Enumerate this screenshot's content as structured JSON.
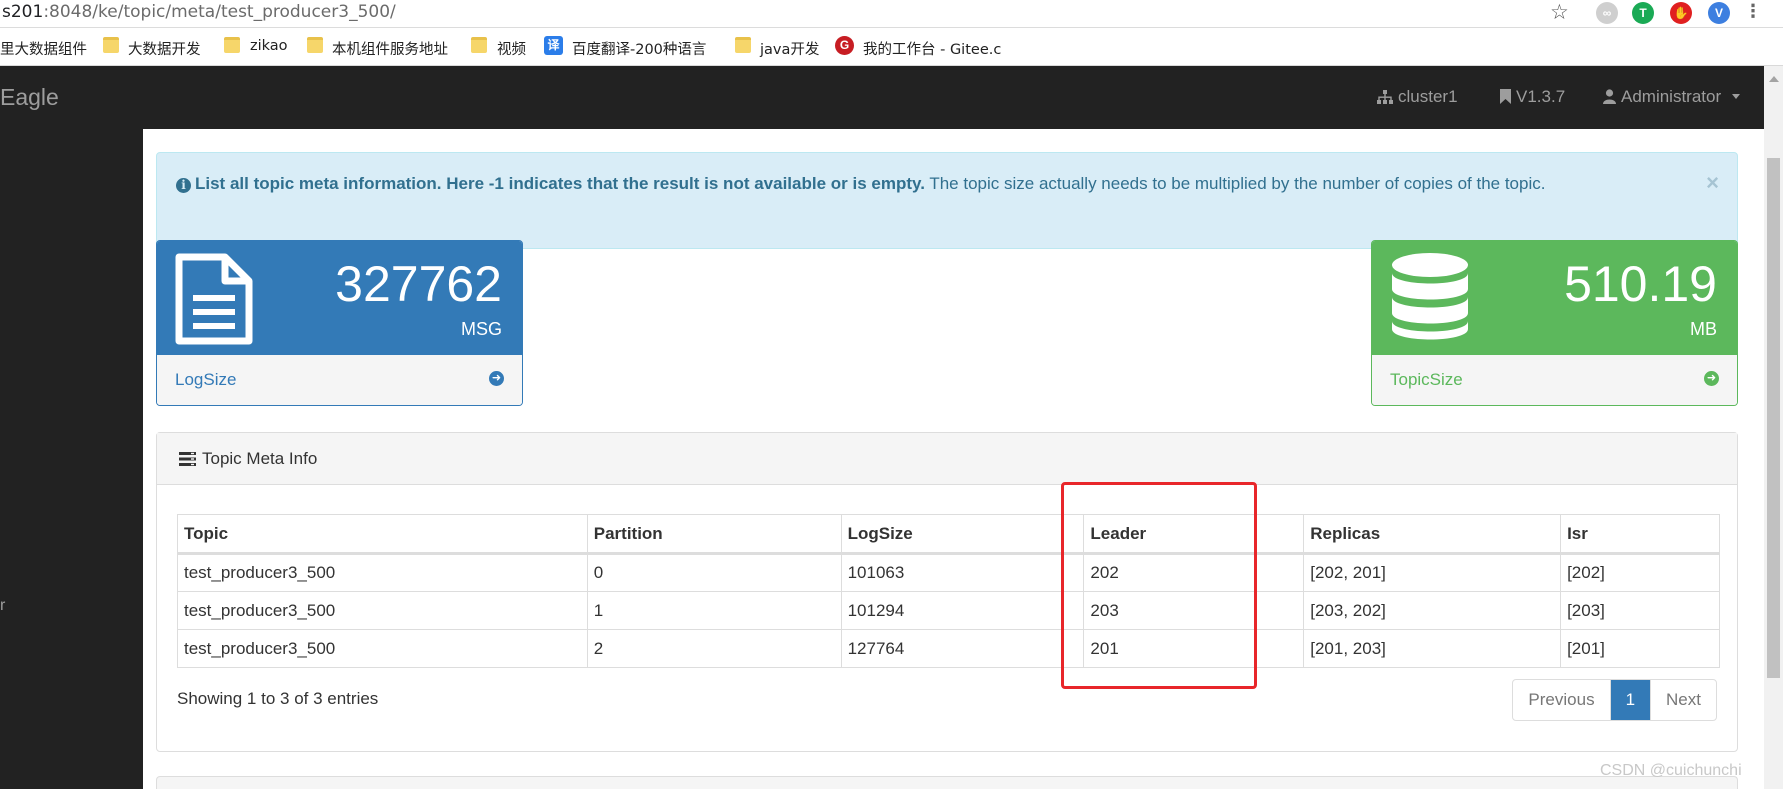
{
  "browser": {
    "url_host": "s201",
    "url_path": ":8048/ke/topic/meta/test_producer3_500/",
    "bookmarks": [
      "里大数据组件",
      "大数据开发",
      "zikao",
      "本机组件服务地址",
      "视频",
      "百度翻译-200种语言",
      "java开发",
      "我的工作台 - Gitee.c"
    ],
    "bookmark_badge_translate": "译",
    "bookmark_badge_gitee": "G"
  },
  "navbar": {
    "brand": "Eagle",
    "cluster": "cluster1",
    "version": "V1.3.7",
    "user": "Administrator"
  },
  "sidebar": {
    "fragment": "r"
  },
  "alert": {
    "bold_text": "List all topic meta information. Here -1 indicates that the result is not available or is empty.",
    "text": " The topic size actually needs to be multiplied by the number of copies of the topic.",
    "close": "×"
  },
  "stats": {
    "logsize": {
      "value": "327762",
      "unit": "MSG",
      "label": "LogSize"
    },
    "topicsize": {
      "value": "510.19",
      "unit": "MB",
      "label": "TopicSize"
    }
  },
  "meta": {
    "title": "Topic Meta Info",
    "columns": [
      "Topic",
      "Partition",
      "LogSize",
      "Leader",
      "Replicas",
      "Isr"
    ],
    "rows": [
      [
        "test_producer3_500",
        "0",
        "101063",
        "202",
        "[202, 201]",
        "[202]"
      ],
      [
        "test_producer3_500",
        "1",
        "101294",
        "203",
        "[203, 202]",
        "[203]"
      ],
      [
        "test_producer3_500",
        "2",
        "127764",
        "201",
        "[201, 203]",
        "[201]"
      ]
    ],
    "showing": "Showing 1 to 3 of 3 entries",
    "pager": {
      "prev": "Previous",
      "current": "1",
      "next": "Next"
    }
  },
  "watermark": "CSDN @cuichunchi",
  "colors": {
    "primary": "#337ab7",
    "success": "#5cb85c",
    "navbar": "#222222",
    "alert_bg": "#d9edf7",
    "highlight": "#e8262a"
  }
}
